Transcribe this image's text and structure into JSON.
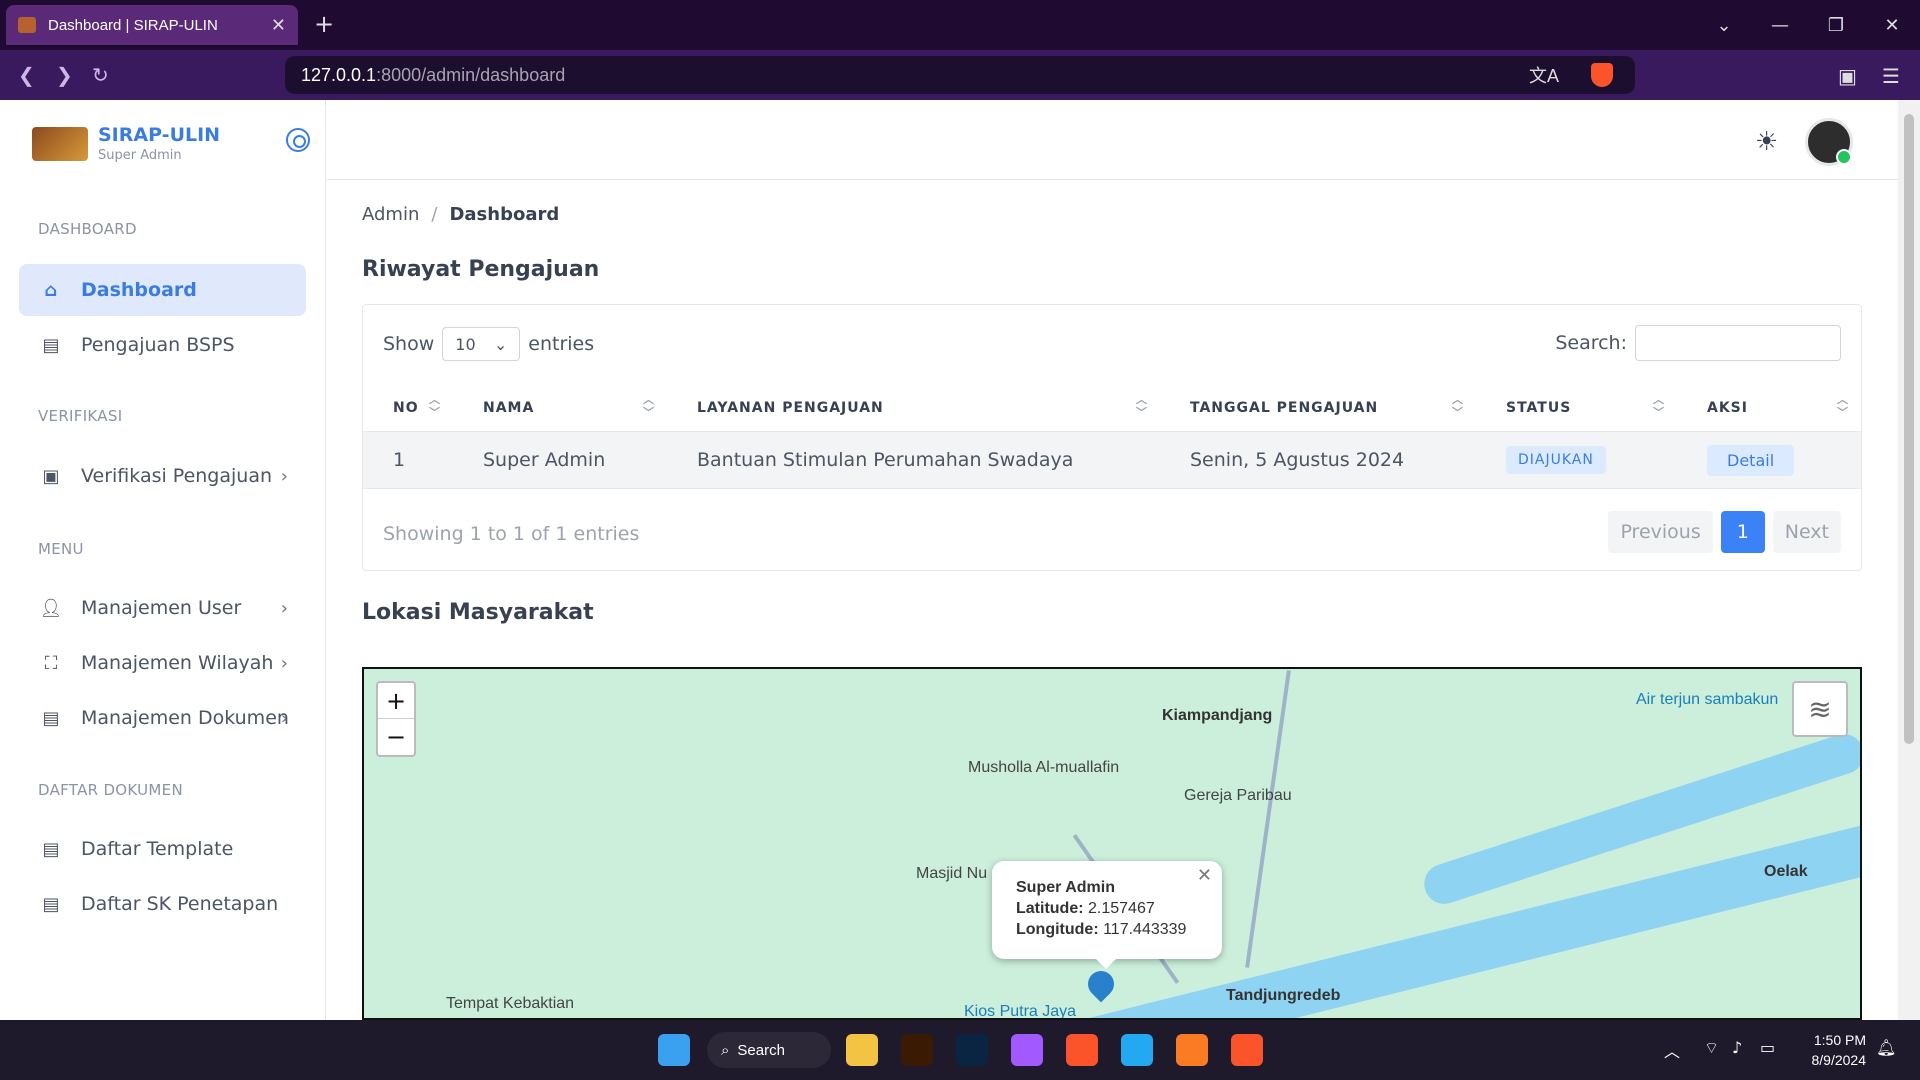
{
  "browser": {
    "tab_title": "Dashboard | SIRAP-ULIN",
    "url_host": "127.0.0.1",
    "url_path": ":8000/admin/dashboard"
  },
  "sidebar": {
    "brand": "SIRAP-ULIN",
    "role": "Super Admin",
    "sections": {
      "dashboard": "DASHBOARD",
      "verifikasi": "VERIFIKASI",
      "menu": "MENU",
      "daftar": "DAFTAR DOKUMEN"
    },
    "items": {
      "dashboard": "Dashboard",
      "pengajuan": "Pengajuan BSPS",
      "verifikasi": "Verifikasi Pengajuan",
      "user": "Manajemen User",
      "wilayah": "Manajemen Wilayah",
      "dokumen": "Manajemen Dokumen",
      "template": "Daftar Template",
      "sk": "Daftar SK Penetapan"
    }
  },
  "breadcrumb": {
    "root": "Admin",
    "current": "Dashboard",
    "sep": "/"
  },
  "riwayat": {
    "title": "Riwayat Pengajuan",
    "show_label": "Show",
    "entries_label": "entries",
    "page_size": "10",
    "search_label": "Search:",
    "columns": [
      "NO",
      "NAMA",
      "LAYANAN PENGAJUAN",
      "TANGGAL PENGAJUAN",
      "STATUS",
      "AKSI"
    ],
    "rows": [
      {
        "no": "1",
        "nama": "Super Admin",
        "layanan": "Bantuan Stimulan Perumahan Swadaya",
        "tanggal": "Senin, 5 Agustus 2024",
        "status": "DIAJUKAN",
        "aksi": "Detail"
      }
    ],
    "info": "Showing 1 to 1 of 1 entries",
    "prev": "Previous",
    "page": "1",
    "next": "Next"
  },
  "lokasi": {
    "title": "Lokasi Masyarakat",
    "zoom_in": "+",
    "zoom_out": "−",
    "labels": {
      "kiampandjang": "Kiampandjang",
      "musholla": "Musholla Al-muallafin",
      "gereja": "Gereja Paribau",
      "air": "Air terjun sambakun",
      "masjid": "Masjid Nu",
      "oelak": "Oelak",
      "tanjung": "Tandjungredeb",
      "kios": "Kios Putra Jaya",
      "kebaktian": "Tempat Kebaktian"
    },
    "popup": {
      "name": "Super Admin",
      "lat_label": "Latitude:",
      "lat": "2.157467",
      "lon_label": "Longitude:",
      "lon": "117.443339"
    }
  },
  "taskbar": {
    "search": "Search",
    "time": "1:50 PM",
    "date": "8/9/2024"
  }
}
